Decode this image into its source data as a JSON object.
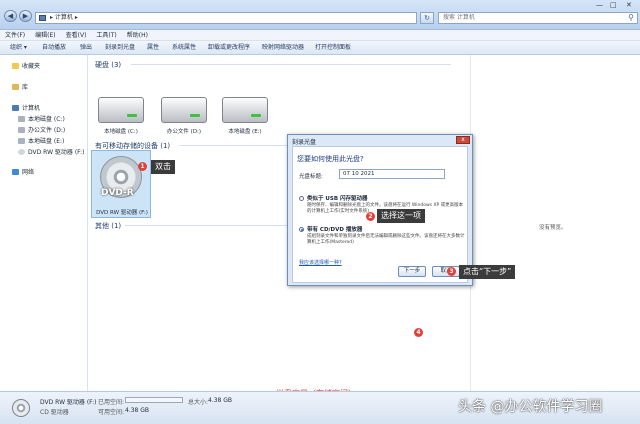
{
  "window": {
    "address": "▸ 计算机 ▸",
    "search_placeholder": "搜索 计算机",
    "minimize": "—",
    "maximize": "□",
    "close": "✕"
  },
  "menu": [
    "文件(F)",
    "编辑(E)",
    "查看(V)",
    "工具(T)",
    "帮助(H)"
  ],
  "toolbar": [
    "组织 ▾",
    "自动播放",
    "弹出",
    "刻录到光盘",
    "属性",
    "系统属性",
    "卸载或更改程序",
    "映射网络驱动器",
    "打开控制面板"
  ],
  "nav": {
    "favorites": "收藏夹",
    "libraries": "库",
    "computer": "计算机",
    "drive_c": "本地磁盘 (C:)",
    "drive_d": "办公文件 (D:)",
    "drive_e": "本地磁盘 (E:)",
    "drive_f": "DVD RW 驱动器 (F:)",
    "network": "网络"
  },
  "content": {
    "hdd_header": "硬盘 (3)",
    "drives": [
      {
        "label": "本地磁盘 (C:)"
      },
      {
        "label": "办公文件 (D:)"
      },
      {
        "label": "本地磁盘 (E:)"
      }
    ],
    "removable_header": "有可移动存储的设备 (1)",
    "dvd_icon_text": "DVD-R",
    "dvd_label": "DVD RW 驱动器 (F:)",
    "other_header": "其他 (1)"
  },
  "annotations": {
    "m1": "1",
    "m2": "2",
    "m3": "3",
    "m4": "4",
    "step1": "双击",
    "step2": "选择这一项",
    "step3": "点击“下一步”",
    "capacity_note": "光盘容量（存储空间）"
  },
  "preview": {
    "text": "没有预览。"
  },
  "dialog": {
    "title": "刻录光盘",
    "close": "x",
    "question": "您要如何使用此光盘?",
    "disc_title_label": "光盘标题:",
    "disc_title_value": "07 10 2021",
    "option1_title": "类似于 USB 闪存驱动器",
    "option1_desc": "随时保存、编辑和删除光盘上的文件。该盘将在运行 Windows XP 或更高版本的计算机上工作(实时文件系统)",
    "option2_title": "带有 CD/DVD 播放器",
    "option2_desc": "成组刻录文件和单独刻录文件后无法编辑或删除这些文件。该盘还将在大多数计算机上工作(Mastered)",
    "link": "我应该选择哪一种?",
    "next_button": "下一步",
    "cancel_button": "取消"
  },
  "status": {
    "drive_name": "DVD RW 驱动器 (F:)",
    "drive_type": "CD 驱动器",
    "used_label": "已用空间:",
    "free_label": "可用空间:",
    "free_value": "4.38 GB",
    "total_label": "总大小:",
    "total_value": "4.38 GB",
    "used_fraction": 0
  },
  "watermark": "头条 @办公软件学习圈"
}
